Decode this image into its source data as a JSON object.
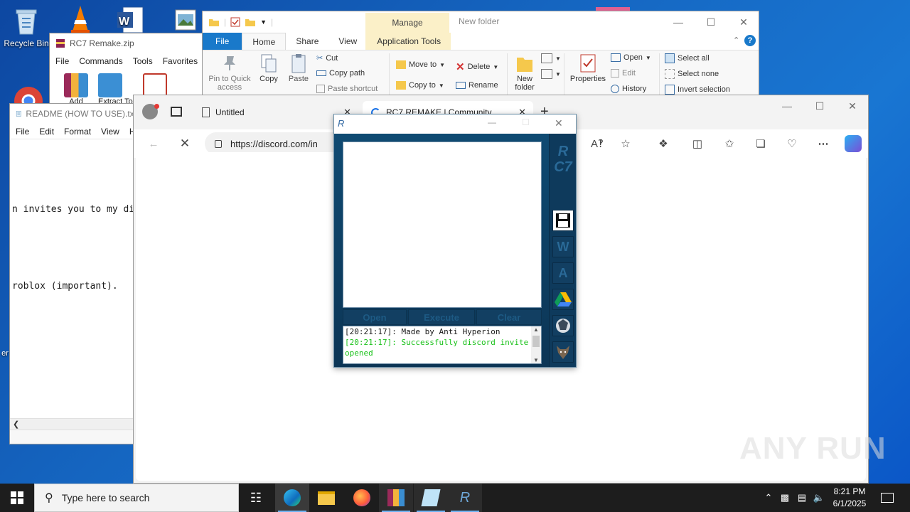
{
  "desktop": {
    "icons": [
      {
        "label": "Recycle Bin"
      },
      {
        "label": "er"
      }
    ]
  },
  "winrar": {
    "title": "RC7 Remake.zip",
    "menu": [
      "File",
      "Commands",
      "Tools",
      "Favorites"
    ],
    "tools": [
      "Add",
      "Extract To"
    ]
  },
  "notepad": {
    "title": "README (HOW TO USE).txt",
    "menu": [
      "File",
      "Edit",
      "Format",
      "View",
      "H"
    ],
    "lines": [
      "",
      "n invites you to my di",
      "",
      "roblox (important).",
      "",
      "",
      "",
      "---------------------"
    ]
  },
  "explorer": {
    "manage": "Manage",
    "folder_title": "New folder",
    "tabs": [
      "File",
      "Home",
      "Share",
      "View",
      "Application Tools"
    ],
    "clipboard": {
      "pin": "Pin to Quick access",
      "copy": "Copy",
      "paste": "Paste",
      "cut": "Cut",
      "copy_path": "Copy path",
      "paste_shortcut": "Paste shortcut"
    },
    "organize": {
      "move_to": "Move to",
      "copy_to": "Copy to",
      "delete": "Delete",
      "rename": "Rename"
    },
    "new": {
      "new_folder": "New folder"
    },
    "open": {
      "properties": "Properties",
      "open": "Open",
      "edit": "Edit",
      "history": "History"
    },
    "select": {
      "select_all": "Select all",
      "select_none": "Select none",
      "invert": "Invert selection"
    }
  },
  "edge": {
    "tabs": [
      {
        "label": "Untitled"
      },
      {
        "label": "RC7 REMAKE | Community"
      }
    ],
    "address": "https://discord.com/in"
  },
  "rc7": {
    "title_logo": "R",
    "brand": "RC7",
    "buttons": {
      "open": "Open",
      "execute": "Execute",
      "clear": "Clear"
    },
    "side": [
      "W",
      "A"
    ],
    "console": [
      {
        "text": "[20:21:17]: Made by Anti Hyperion",
        "color": "#000000"
      },
      {
        "text": "[20:21:17]: Successfully discord invite opened",
        "color": "#19c119"
      }
    ]
  },
  "taskbar": {
    "search_placeholder": "Type here to search",
    "time": "8:21 PM",
    "date": "6/1/2025"
  },
  "watermark": "ANY RUN"
}
